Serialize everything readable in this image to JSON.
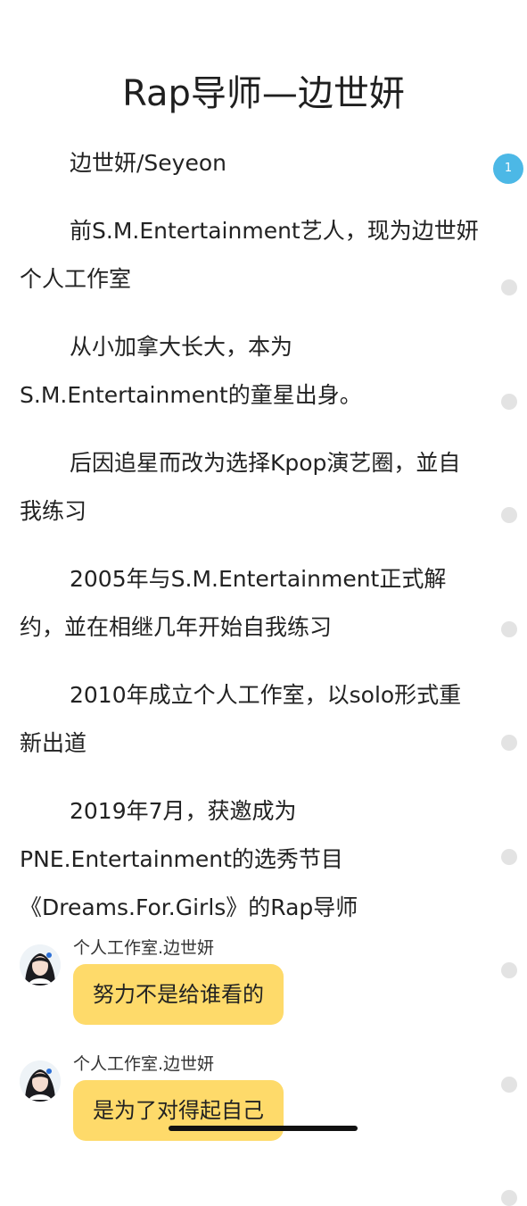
{
  "title": "Rap导师—边世妍",
  "paragraphs": [
    "边世妍/Seyeon",
    "前S.M.Entertainment艺人，现为边世妍个人工作室",
    "从小加拿大长大，本为S.M.Entertainment的童星出身。",
    "后因追星而改为选择Kpop演艺圈，並自我练习",
    "2005年与S.M.Entertainment正式解约，並在相继几年开始自我练习",
    "2010年成立个人工作室，以solo形式重新出道",
    "2019年7月，获邀成为PNE.Entertainment的选秀节目《Dreams.For.Girls》的Rap导师"
  ],
  "messages": [
    {
      "sender": "个人工作室.边世妍",
      "text": "努力不是给谁看的"
    },
    {
      "sender": "个人工作室.边世妍",
      "text": "是为了对得起自己"
    }
  ],
  "progress": {
    "current_page_label": "1",
    "page_count": 10
  },
  "colors": {
    "bubble": "#FEDA6A",
    "active_dot": "#4CB8E6",
    "inactive_dot": "#E3E3E3",
    "text": "#222222"
  },
  "icons": {
    "avatar": "user-avatar-portrait"
  }
}
